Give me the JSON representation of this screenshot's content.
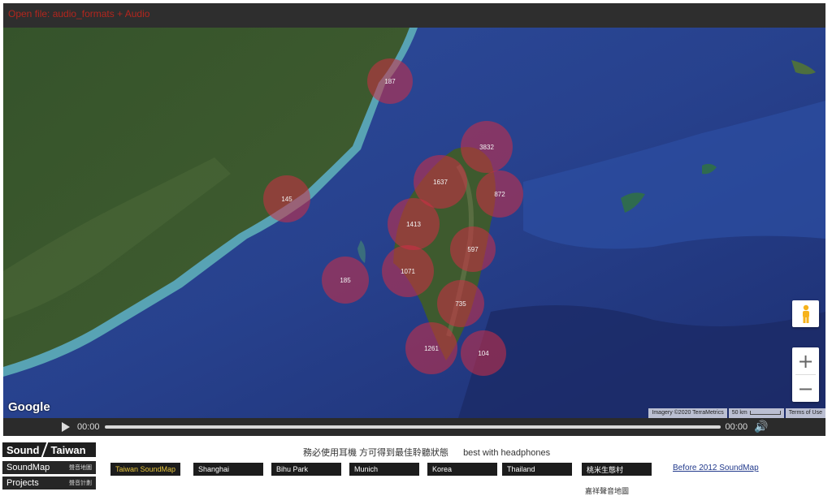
{
  "topbar": {
    "status_text": "Open file: audio_formats + Audio"
  },
  "map": {
    "clusters": [
      {
        "id": "fuzhou",
        "count": "187"
      },
      {
        "id": "xiamen",
        "count": "145"
      },
      {
        "id": "penghu",
        "count": "185"
      },
      {
        "id": "taipei",
        "count": "3832"
      },
      {
        "id": "taoyuan",
        "count": "1637"
      },
      {
        "id": "yilan",
        "count": "872"
      },
      {
        "id": "hsinchu",
        "count": "1413"
      },
      {
        "id": "hualien",
        "count": "597"
      },
      {
        "id": "taichung",
        "count": "1071"
      },
      {
        "id": "taitung",
        "count": "735"
      },
      {
        "id": "kaohsiung",
        "count": "1261"
      },
      {
        "id": "hengchun",
        "count": "104"
      }
    ],
    "google_logo": "Google",
    "imagery": "Imagery ©2020 TerraMetrics",
    "scale": "50 km",
    "terms": "Terms of Use",
    "zoom_in": "+",
    "zoom_out": "−"
  },
  "player": {
    "current_time": "00:00",
    "total_time": "00:00"
  },
  "site": {
    "logo_left": "Sound",
    "logo_right": "Taiwan",
    "soundmap_label": "SoundMap",
    "soundmap_sub": "聲音地圖",
    "projects_label": "Projects",
    "projects_sub": "聲音計劃"
  },
  "notice": {
    "zh": "務必使用耳機 方可得到最佳聆聽狀態",
    "en": "best with headphones"
  },
  "tabs": [
    {
      "label": "Taiwan SoundMap",
      "active": true
    },
    {
      "label": "Shanghai",
      "active": false
    },
    {
      "label": "Bihu Park",
      "active": false
    },
    {
      "label": "Munich",
      "active": false
    },
    {
      "label": "Korea",
      "active": false
    },
    {
      "label": "Thailand",
      "active": false
    },
    {
      "label": "桃米生態村",
      "active": false
    }
  ],
  "before_link": "Before 2012 SoundMap",
  "extra_text": "嘉祥聲音地圖"
}
